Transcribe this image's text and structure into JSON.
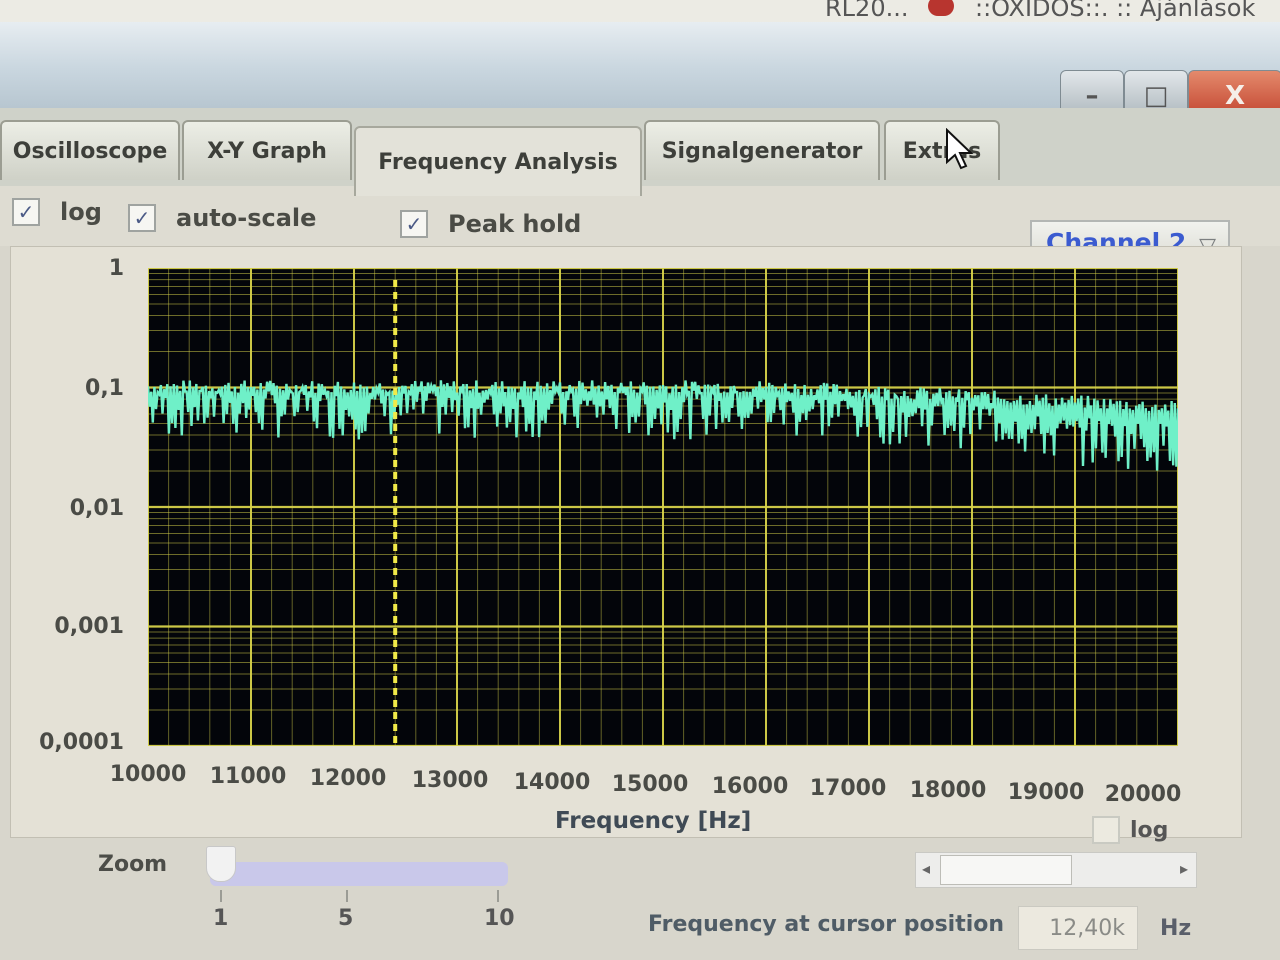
{
  "browser_strip": {
    "fragments": [
      "RL20...",
      "::OXIDOS::. :: Ajánlások"
    ]
  },
  "window_controls": {
    "minimize": "–",
    "maximize": "□",
    "close": "X"
  },
  "tabs": [
    {
      "label": "Oscilloscope",
      "active": false
    },
    {
      "label": "X-Y Graph",
      "active": false
    },
    {
      "label": "Frequency Analysis",
      "active": true
    },
    {
      "label": "Signalgenerator",
      "active": false
    },
    {
      "label": "Extras",
      "active": false
    }
  ],
  "options": {
    "log": {
      "label": "log",
      "checked": true
    },
    "auto_scale": {
      "label": "auto-scale",
      "checked": true
    },
    "peak_hold": {
      "label": "Peak hold",
      "checked": true
    }
  },
  "channel_select": {
    "value": "Channel 2"
  },
  "plot": {
    "y_tick_labels": [
      "1",
      "0,1",
      "0,01",
      "0,001",
      "0,0001"
    ],
    "x_tick_labels": [
      "10000",
      "11000",
      "12000",
      "13000",
      "14000",
      "15000",
      "16000",
      "17000",
      "18000",
      "19000",
      "20000"
    ],
    "x_axis_title": "Frequency [Hz]",
    "x_log_label": "log",
    "x_log_checked": false,
    "cursor_frequency": 12400,
    "colors": {
      "background": "#03050a",
      "grid": "#d6d24a",
      "trace": "#6ff0c8",
      "cursor": "#f1ea48"
    }
  },
  "zoom": {
    "label": "Zoom",
    "value": 1,
    "ticks": [
      "1",
      "5",
      "10"
    ]
  },
  "cursor_readout": {
    "label": "Frequency at cursor position",
    "value": "12,40k",
    "unit": "Hz"
  }
}
